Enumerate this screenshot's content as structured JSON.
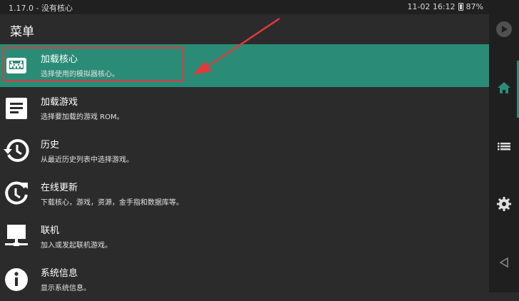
{
  "status_bar": {
    "left_text": "1.17.0 - 没有核心",
    "time_text": "11-02 16:12",
    "battery_text": "87%",
    "battery_icon": "battery-icon"
  },
  "header": {
    "title": "菜单"
  },
  "menu": {
    "items": [
      {
        "icon": "space-invader-icon",
        "label": "加载核心",
        "sub": "选择使用的模拟器核心。",
        "selected": true
      },
      {
        "icon": "document-list-icon",
        "label": "加载游戏",
        "sub": "选择要加载的游戏 ROM。"
      },
      {
        "icon": "history-icon",
        "label": "历史",
        "sub": "从最近历史列表中选择游戏。"
      },
      {
        "icon": "update-icon",
        "label": "在线更新",
        "sub": "下载核心，游戏，资源，金手指和数据库等。"
      },
      {
        "icon": "netplay-icon",
        "label": "联机",
        "sub": "加入或发起联机游戏。"
      },
      {
        "icon": "info-icon",
        "label": "系统信息",
        "sub": "显示系统信息。"
      }
    ]
  },
  "side_rail": {
    "items": [
      "play-icon",
      "home-icon",
      "list-icon",
      "gear-icon",
      "back-triangle-icon"
    ],
    "accent_color": "#2a8c76"
  },
  "colors": {
    "selected_bg": "#2a8c76",
    "annotation": "#e2393f",
    "background": "#2b2b2b"
  }
}
